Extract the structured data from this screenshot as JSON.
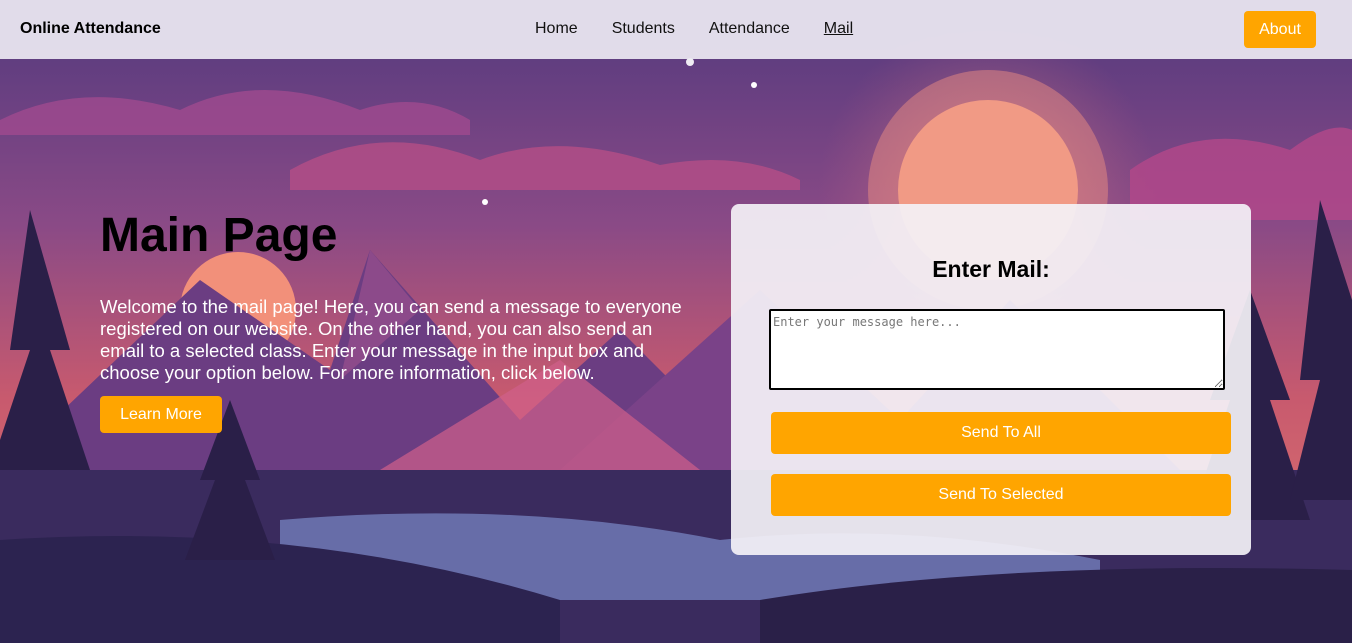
{
  "navbar": {
    "brand": "Online Attendance",
    "links": [
      "Home",
      "Students",
      "Attendance",
      "Mail"
    ],
    "active_link": "Mail",
    "about_label": "About"
  },
  "hero": {
    "title": "Main Page",
    "description": "Welcome to the mail page! Here, you can send a message to everyone registered on our website. On the other hand, you can also send an email to a selected class. Enter your message in the input box and choose your option below. For more information, click below.",
    "learn_more_label": "Learn More"
  },
  "mail_card": {
    "heading": "Enter Mail:",
    "message_placeholder": "Enter your message here...",
    "message_value": "",
    "send_all_label": "Send To All",
    "send_selected_label": "Send To Selected"
  },
  "colors": {
    "accent": "#ffa500",
    "navbar_bg": "#ece8f2",
    "card_bg": "#f4f2f7",
    "sky_top": "#5a3e86",
    "sky_mid": "#c0506e",
    "sun": "#f2907a"
  }
}
